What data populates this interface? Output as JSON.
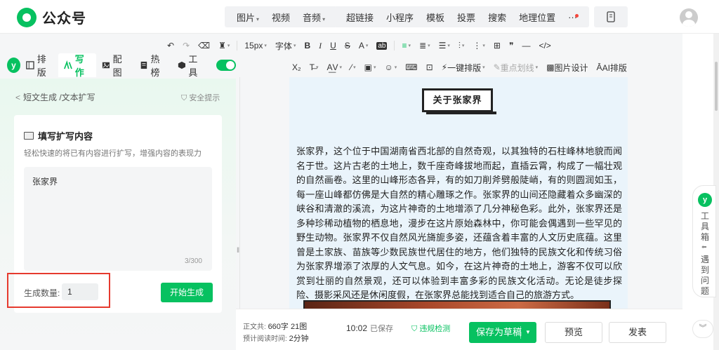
{
  "app": {
    "name": "公众号"
  },
  "topmenu": {
    "group1": [
      "图片",
      "视频",
      "音频"
    ],
    "group2": [
      "超链接",
      "小程序",
      "模板",
      "投票",
      "搜索",
      "地理位置",
      "···"
    ]
  },
  "leftnav": {
    "items": [
      {
        "label": "排版",
        "icon": "layout-icon"
      },
      {
        "label": "写作",
        "icon": "ai-write-icon",
        "active": true
      },
      {
        "label": "配图",
        "icon": "image-icon"
      },
      {
        "label": "热榜",
        "icon": "hot-list-icon"
      },
      {
        "label": "工具",
        "icon": "toolbox-icon"
      }
    ]
  },
  "toolbar": {
    "row1": [
      "↶",
      "↷",
      "⌫",
      "♜",
      "15px",
      "字体",
      "B",
      "I",
      "U",
      "S",
      "A",
      "ab",
      "≡",
      "≣",
      "☰",
      "⫶",
      "⋮",
      "⊞",
      "❞",
      "—",
      "</>"
    ],
    "font_size": "15px",
    "font_label": "字体",
    "row2_onekey": "一键排版",
    "row2_highlight": "重点划线",
    "row2_picdesign": "图片设计",
    "row2_ai": "AI排版"
  },
  "panel": {
    "back_label": "短文生成 /文本扩写",
    "safe_label": "安全提示",
    "card_title": "填写扩写内容",
    "card_desc": "轻松快速的将已有内容进行扩写，增强内容的表现力",
    "input_value": "张家界",
    "input_count": "3/300",
    "count_label": "生成数量:",
    "count_value": "1",
    "generate_label": "开始生成"
  },
  "article": {
    "heading": "关于张家界",
    "body": "张家界，这个位于中国湖南省西北部的自然奇观，以其独特的石柱峰林地貌而闻名于世。这片古老的土地上，数千座奇峰拔地而起，直插云霄，构成了一幅壮观的自然画卷。这里的山峰形态各异，有的如刀削斧劈般陡峭，有的则圆润如玉，每一座山峰都仿佛是大自然的精心雕琢之作。张家界的山间还隐藏着众多幽深的峡谷和清澈的溪流，为这片神奇的土地增添了几分神秘色彩。此外，张家界还是多种珍稀动植物的栖息地，漫步在这片原始森林中，你可能会偶遇到一些罕见的野生动物。张家界不仅自然风光旖旎多姿，还蕴含着丰富的人文历史底蕴。这里曾是土家族、苗族等少数民族世代居住的地方，他们独特的民族文化和传统习俗为张家界增添了浓厚的人文气息。如今，在这片神奇的土地上，游客不仅可以欣赏到壮丽的自然景观，还可以体验到丰富多彩的民族文化活动。无论是徒步探险、摄影采风还是休闲度假，在张家界总能找到适合自己的旅游方式。"
  },
  "footer": {
    "stats_label": "正文共:",
    "word_count": "660字 21图",
    "read_label": "预计阅读时间:",
    "read_time": "2分钟",
    "save_time": "10:02",
    "saved_label": "已保存",
    "check_label": "违规检测",
    "save_draft": "保存为草稿",
    "preview": "预览",
    "publish": "发表"
  },
  "sidebar_right": {
    "toolbox_label": "工具箱",
    "feedback_label": "遇到问题"
  },
  "colors": {
    "brand": "#07c160",
    "alert": "#e63a2e"
  }
}
